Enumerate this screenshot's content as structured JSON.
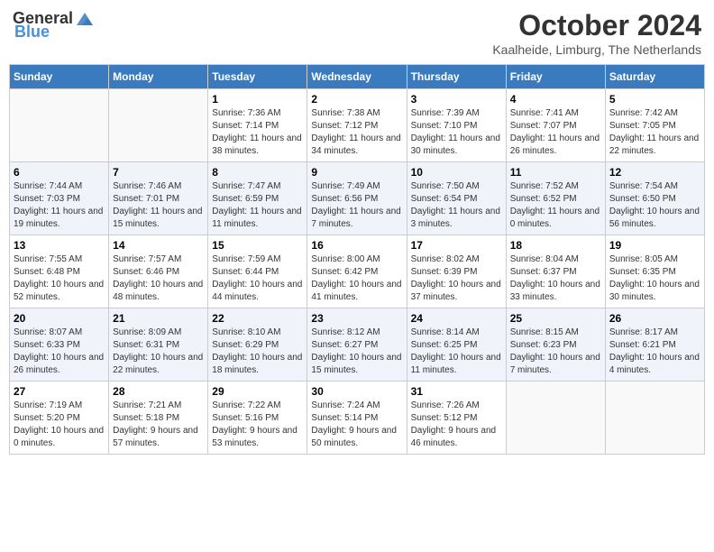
{
  "header": {
    "logo_general": "General",
    "logo_blue": "Blue",
    "month": "October 2024",
    "location": "Kaalheide, Limburg, The Netherlands"
  },
  "weekdays": [
    "Sunday",
    "Monday",
    "Tuesday",
    "Wednesday",
    "Thursday",
    "Friday",
    "Saturday"
  ],
  "weeks": [
    [
      {
        "day": "",
        "info": ""
      },
      {
        "day": "",
        "info": ""
      },
      {
        "day": "1",
        "info": "Sunrise: 7:36 AM\nSunset: 7:14 PM\nDaylight: 11 hours and 38 minutes."
      },
      {
        "day": "2",
        "info": "Sunrise: 7:38 AM\nSunset: 7:12 PM\nDaylight: 11 hours and 34 minutes."
      },
      {
        "day": "3",
        "info": "Sunrise: 7:39 AM\nSunset: 7:10 PM\nDaylight: 11 hours and 30 minutes."
      },
      {
        "day": "4",
        "info": "Sunrise: 7:41 AM\nSunset: 7:07 PM\nDaylight: 11 hours and 26 minutes."
      },
      {
        "day": "5",
        "info": "Sunrise: 7:42 AM\nSunset: 7:05 PM\nDaylight: 11 hours and 22 minutes."
      }
    ],
    [
      {
        "day": "6",
        "info": "Sunrise: 7:44 AM\nSunset: 7:03 PM\nDaylight: 11 hours and 19 minutes."
      },
      {
        "day": "7",
        "info": "Sunrise: 7:46 AM\nSunset: 7:01 PM\nDaylight: 11 hours and 15 minutes."
      },
      {
        "day": "8",
        "info": "Sunrise: 7:47 AM\nSunset: 6:59 PM\nDaylight: 11 hours and 11 minutes."
      },
      {
        "day": "9",
        "info": "Sunrise: 7:49 AM\nSunset: 6:56 PM\nDaylight: 11 hours and 7 minutes."
      },
      {
        "day": "10",
        "info": "Sunrise: 7:50 AM\nSunset: 6:54 PM\nDaylight: 11 hours and 3 minutes."
      },
      {
        "day": "11",
        "info": "Sunrise: 7:52 AM\nSunset: 6:52 PM\nDaylight: 11 hours and 0 minutes."
      },
      {
        "day": "12",
        "info": "Sunrise: 7:54 AM\nSunset: 6:50 PM\nDaylight: 10 hours and 56 minutes."
      }
    ],
    [
      {
        "day": "13",
        "info": "Sunrise: 7:55 AM\nSunset: 6:48 PM\nDaylight: 10 hours and 52 minutes."
      },
      {
        "day": "14",
        "info": "Sunrise: 7:57 AM\nSunset: 6:46 PM\nDaylight: 10 hours and 48 minutes."
      },
      {
        "day": "15",
        "info": "Sunrise: 7:59 AM\nSunset: 6:44 PM\nDaylight: 10 hours and 44 minutes."
      },
      {
        "day": "16",
        "info": "Sunrise: 8:00 AM\nSunset: 6:42 PM\nDaylight: 10 hours and 41 minutes."
      },
      {
        "day": "17",
        "info": "Sunrise: 8:02 AM\nSunset: 6:39 PM\nDaylight: 10 hours and 37 minutes."
      },
      {
        "day": "18",
        "info": "Sunrise: 8:04 AM\nSunset: 6:37 PM\nDaylight: 10 hours and 33 minutes."
      },
      {
        "day": "19",
        "info": "Sunrise: 8:05 AM\nSunset: 6:35 PM\nDaylight: 10 hours and 30 minutes."
      }
    ],
    [
      {
        "day": "20",
        "info": "Sunrise: 8:07 AM\nSunset: 6:33 PM\nDaylight: 10 hours and 26 minutes."
      },
      {
        "day": "21",
        "info": "Sunrise: 8:09 AM\nSunset: 6:31 PM\nDaylight: 10 hours and 22 minutes."
      },
      {
        "day": "22",
        "info": "Sunrise: 8:10 AM\nSunset: 6:29 PM\nDaylight: 10 hours and 18 minutes."
      },
      {
        "day": "23",
        "info": "Sunrise: 8:12 AM\nSunset: 6:27 PM\nDaylight: 10 hours and 15 minutes."
      },
      {
        "day": "24",
        "info": "Sunrise: 8:14 AM\nSunset: 6:25 PM\nDaylight: 10 hours and 11 minutes."
      },
      {
        "day": "25",
        "info": "Sunrise: 8:15 AM\nSunset: 6:23 PM\nDaylight: 10 hours and 7 minutes."
      },
      {
        "day": "26",
        "info": "Sunrise: 8:17 AM\nSunset: 6:21 PM\nDaylight: 10 hours and 4 minutes."
      }
    ],
    [
      {
        "day": "27",
        "info": "Sunrise: 7:19 AM\nSunset: 5:20 PM\nDaylight: 10 hours and 0 minutes."
      },
      {
        "day": "28",
        "info": "Sunrise: 7:21 AM\nSunset: 5:18 PM\nDaylight: 9 hours and 57 minutes."
      },
      {
        "day": "29",
        "info": "Sunrise: 7:22 AM\nSunset: 5:16 PM\nDaylight: 9 hours and 53 minutes."
      },
      {
        "day": "30",
        "info": "Sunrise: 7:24 AM\nSunset: 5:14 PM\nDaylight: 9 hours and 50 minutes."
      },
      {
        "day": "31",
        "info": "Sunrise: 7:26 AM\nSunset: 5:12 PM\nDaylight: 9 hours and 46 minutes."
      },
      {
        "day": "",
        "info": ""
      },
      {
        "day": "",
        "info": ""
      }
    ]
  ]
}
